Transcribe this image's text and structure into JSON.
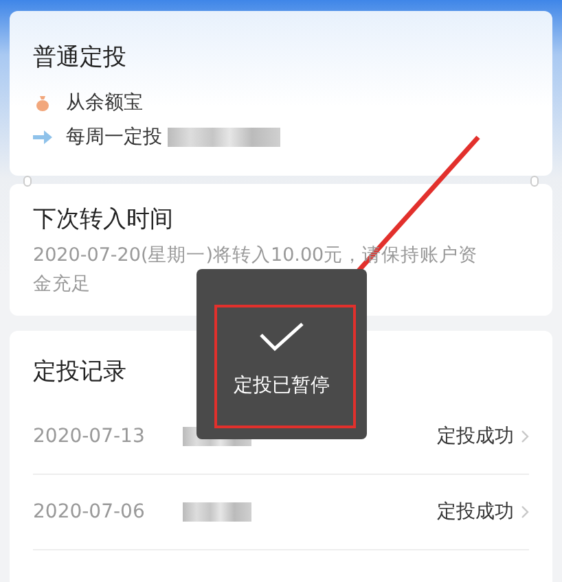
{
  "plan_card": {
    "title": "普通定投",
    "rows": [
      {
        "kind": "source",
        "text": "从余额宝",
        "blurred": false
      },
      {
        "kind": "schedule",
        "text": "每周一定投",
        "blurred": true
      }
    ]
  },
  "next_card": {
    "title": "下次转入时间",
    "text": "2020-07-20(星期一)将转入10.00元，请保持账户资金充足"
  },
  "records_card": {
    "title": "定投记录",
    "records": [
      {
        "date": "2020-07-13",
        "status": "定投成功"
      },
      {
        "date": "2020-07-06",
        "status": "定投成功"
      }
    ]
  },
  "toast": {
    "text": "定投已暂停"
  }
}
